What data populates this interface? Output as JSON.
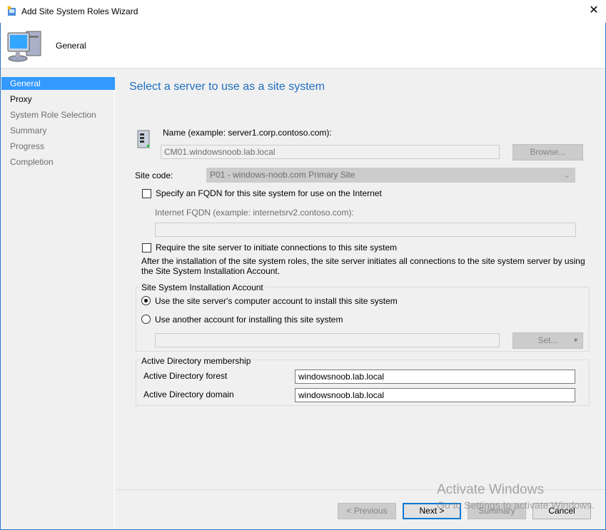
{
  "window": {
    "title": "Add Site System Roles Wizard",
    "close_icon": "close-icon"
  },
  "header": {
    "title": "General"
  },
  "sidebar": {
    "items": [
      {
        "label": "General"
      },
      {
        "label": "Proxy"
      },
      {
        "label": "System Role Selection"
      },
      {
        "label": "Summary"
      },
      {
        "label": "Progress"
      },
      {
        "label": "Completion"
      }
    ]
  },
  "main": {
    "heading": "Select a server to use as a site system",
    "name_label": "Name (example: server1.corp.contoso.com):",
    "name_value": "CM01.windowsnoob.lab.local",
    "browse_label": "Browse...",
    "site_code_label": "Site code:",
    "site_code_value": "P01 - windows-noob.com Primary Site",
    "fqdn_checkbox": "Specify an FQDN for this site system for use on the Internet",
    "fqdn_checked": false,
    "internet_fqdn_label": "Internet FQDN (example: internetsrv2.contoso.com):",
    "internet_fqdn_value": "",
    "require_checkbox": "Require the site server to initiate connections to this site system",
    "require_checked": false,
    "require_note": "After the  installation of the site system roles, the site server initiates all connections to the site system server by using the Site System Installation Account.",
    "account_group": {
      "title": "Site System Installation Account",
      "option1": "Use the site server's computer account to install this site system",
      "option2": "Use another account for installing this site system",
      "selected": "option1",
      "account_value": "",
      "set_label": "Set..."
    },
    "ad_group": {
      "title": "Active Directory membership",
      "forest_label": "Active Directory forest",
      "forest_value": "windowsnoob.lab.local",
      "domain_label": "Active Directory domain",
      "domain_value": "windowsnoob.lab.local"
    }
  },
  "footer": {
    "previous": "< Previous",
    "next": "Next >",
    "summary": "Summary",
    "cancel": "Cancel"
  },
  "watermark": {
    "line1": "Activate Windows",
    "line2": "Go to Settings to activate Windows."
  },
  "colors": {
    "accent": "#3399ff",
    "heading": "#1e6fbf",
    "default_button_border": "#0078d7"
  }
}
